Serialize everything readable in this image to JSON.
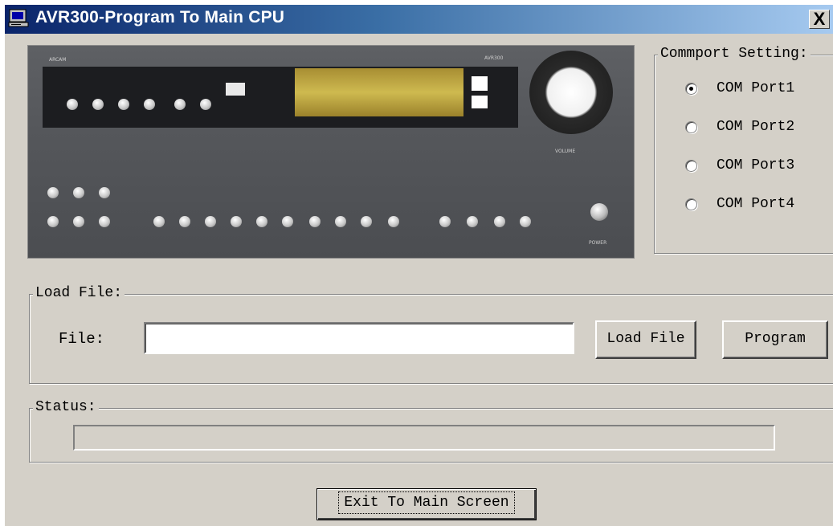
{
  "window": {
    "title": "AVR300-Program To Main CPU",
    "close_glyph": "X",
    "icon": "computer-icon"
  },
  "device_image": {
    "description_icon": "av-receiver-front-panel-image",
    "brand": "ARCAM",
    "model": "AVR300",
    "power_label": "POWER",
    "volume_label": "VOLUME"
  },
  "commport": {
    "label": "Commport Setting:",
    "options": [
      {
        "label": "COM Port1",
        "checked": true
      },
      {
        "label": "COM Port2",
        "checked": false
      },
      {
        "label": "COM Port3",
        "checked": false
      },
      {
        "label": "COM Port4",
        "checked": false
      }
    ]
  },
  "load_file": {
    "group_label": "Load File:",
    "file_label": "File:",
    "file_value": "",
    "load_button": "Load File",
    "program_button": "Program"
  },
  "status": {
    "group_label": "Status:",
    "progress": 0
  },
  "footer": {
    "exit_button": "Exit To Main Screen"
  },
  "colors": {
    "titlebar_start": "#0a246a",
    "titlebar_end": "#a6caf0",
    "face": "#d4d0c8"
  }
}
